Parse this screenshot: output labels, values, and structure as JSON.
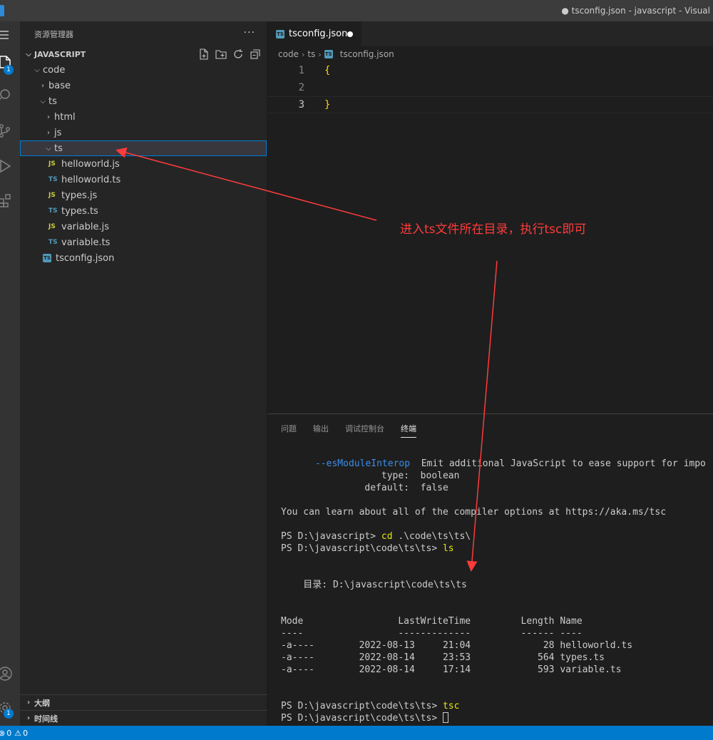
{
  "window": {
    "title": "● tsconfig.json - javascript - Visual"
  },
  "activity_bar": {
    "explorer_badge": "1",
    "settings_badge": "1",
    "icons": [
      "menu-icon",
      "files-icon",
      "search-icon",
      "source-control-icon",
      "run-debug-icon",
      "extensions-icon",
      "account-icon",
      "settings-gear-icon"
    ]
  },
  "sidebar": {
    "header": "资源管理器",
    "more": "···",
    "workspace": "JAVASCRIPT",
    "tree": [
      {
        "label": "code",
        "type": "folder",
        "expanded": true
      },
      {
        "label": "base",
        "type": "folder",
        "expanded": false
      },
      {
        "label": "ts",
        "type": "folder",
        "expanded": true
      },
      {
        "label": "html",
        "type": "folder",
        "expanded": false
      },
      {
        "label": "js",
        "type": "folder",
        "expanded": false
      },
      {
        "label": "ts",
        "type": "folder",
        "expanded": true,
        "selected": true
      },
      {
        "label": "helloworld.js",
        "type": "js",
        "icon": "JS"
      },
      {
        "label": "helloworld.ts",
        "type": "ts",
        "icon": "TS"
      },
      {
        "label": "types.js",
        "type": "js",
        "icon": "JS"
      },
      {
        "label": "types.ts",
        "type": "ts",
        "icon": "TS"
      },
      {
        "label": "variable.js",
        "type": "js",
        "icon": "JS"
      },
      {
        "label": "variable.ts",
        "type": "ts",
        "icon": "TS"
      },
      {
        "label": "tsconfig.json",
        "type": "json"
      }
    ],
    "outline": "大纲",
    "timeline": "时间线"
  },
  "editor": {
    "tab_label": "tsconfig.json",
    "breadcrumb": [
      "code",
      "ts",
      "tsconfig.json"
    ],
    "lines": [
      {
        "num": "1",
        "text": "{"
      },
      {
        "num": "2",
        "text": ""
      },
      {
        "num": "3",
        "text": "}"
      }
    ]
  },
  "panel": {
    "tabs": [
      "问题",
      "输出",
      "调试控制台",
      "终端"
    ],
    "active_tab": "终端",
    "terminal": {
      "opt_flag": "--esModuleInterop",
      "opt_desc": "  Emit additional JavaScript to ease support for impo",
      "opt_type": "                  type:  boolean",
      "opt_default": "               default:  false",
      "learn": "You can learn about all of the compiler options at https://aka.ms/tsc",
      "prompt1": "PS D:\\javascript> ",
      "cmd1": "cd",
      "cmd1_args": " .\\code\\ts\\ts\\",
      "prompt2": "PS D:\\javascript\\code\\ts\\ts> ",
      "cmd2": "ls",
      "dir_line": "    目录: D:\\javascript\\code\\ts\\ts",
      "table_header": "Mode                 LastWriteTime         Length Name",
      "table_sep": "----                 -------------         ------ ----",
      "rows": [
        "-a----        2022-08-13     21:04             28 helloworld.ts",
        "-a----        2022-08-14     23:53            564 types.ts",
        "-a----        2022-08-14     17:14            593 variable.ts"
      ],
      "prompt3": "PS D:\\javascript\\code\\ts\\ts> ",
      "cmd3": "tsc",
      "prompt4": "PS D:\\javascript\\code\\ts\\ts> "
    }
  },
  "status_bar": {
    "errors": "0",
    "warnings": "0"
  },
  "annotation": {
    "text": "进入ts文件所在目录，执行tsc即可",
    "color": "#ff3b3b"
  }
}
